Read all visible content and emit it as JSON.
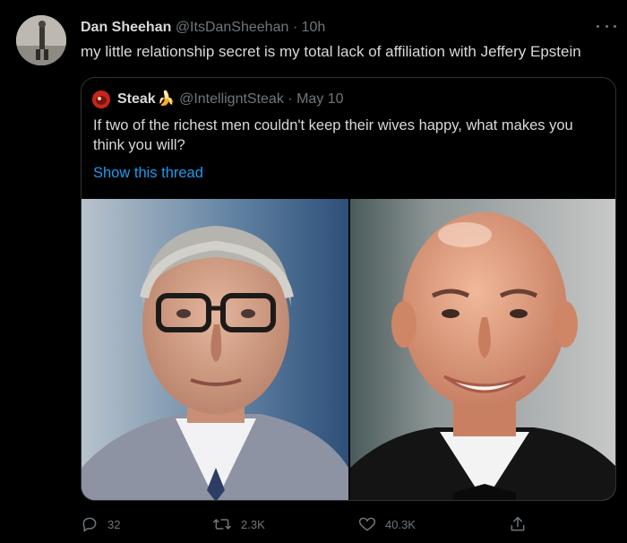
{
  "tweet": {
    "author": {
      "display_name": "Dan Sheehan",
      "handle": "@ItsDanSheehan",
      "separator": "·",
      "time": "10h"
    },
    "text": "my little relationship secret is my total lack of affiliation with Jeffery Epstein",
    "more_icon": "more-horizontal-icon"
  },
  "quoted_tweet": {
    "author": {
      "display_name": "Steak",
      "emoji": "🍌",
      "handle": "@IntelligntSteak",
      "separator": "·",
      "date": "May 10"
    },
    "text": "If two of the richest men couldn't keep their wives happy, what makes you think you will?",
    "thread_link": "Show this thread",
    "images": [
      "left-portrait-photo",
      "right-portrait-photo"
    ]
  },
  "actions": {
    "reply_count": "32",
    "retweet_count": "2.3K",
    "like_count": "40.3K",
    "icons": [
      "reply-icon",
      "retweet-icon",
      "like-icon",
      "share-icon"
    ]
  },
  "colors": {
    "background": "#000000",
    "text": "#d9d9d9",
    "muted": "#6e767d",
    "link": "#1d9bf0",
    "border": "#2f3336"
  }
}
